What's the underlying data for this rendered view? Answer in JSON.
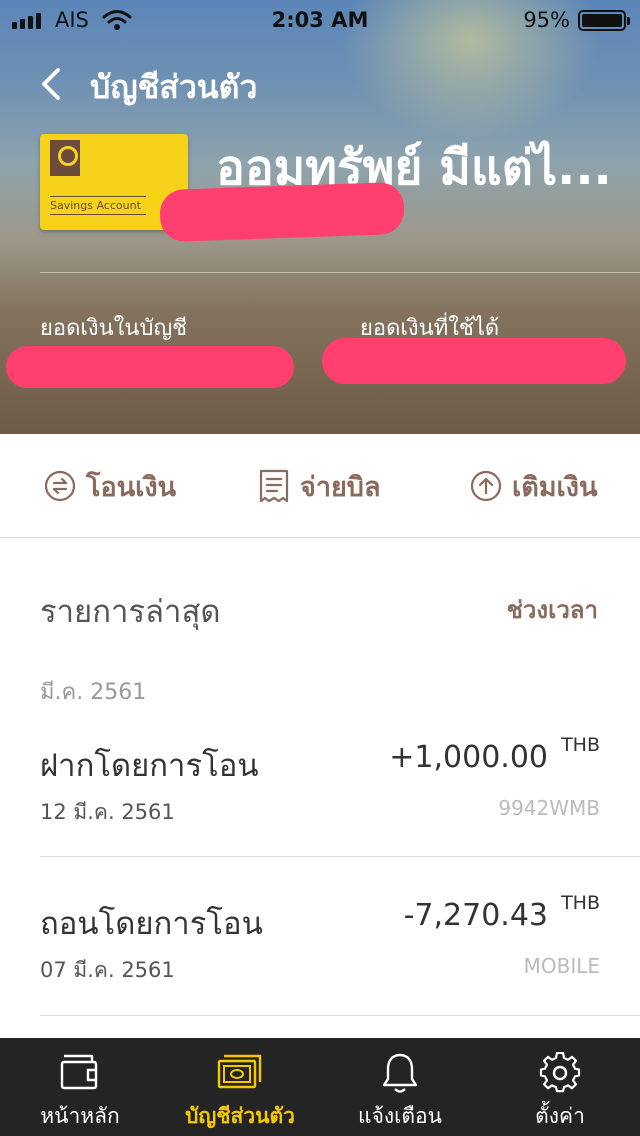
{
  "status_bar": {
    "carrier": "AIS",
    "time": "2:03 AM",
    "battery": "95%",
    "battery_level": 0.95
  },
  "header": {
    "back_icon": "chevron-left-icon",
    "title": "บัญชีส่วนตัว",
    "account_name": "ออมทรัพย์ มีแต่ไ...",
    "card_label": "Savings Account",
    "card_logo_text": "krungsri",
    "balance_label": "ยอดเงินในบัญชี",
    "available_label": "ยอดเงินที่ใช้ได้",
    "redaction_color": "#ff3f6e"
  },
  "actions": [
    {
      "icon": "transfer-icon",
      "label": "โอนเงิน"
    },
    {
      "icon": "bill-icon",
      "label": "จ่ายบิล"
    },
    {
      "icon": "top-up-icon",
      "label": "เติมเงิน"
    }
  ],
  "transactions": {
    "title": "รายการล่าสุด",
    "period_link": "ช่วงเวลา",
    "month": "มี.ค. 2561",
    "items": [
      {
        "title": "ฝากโดยการโอน",
        "amount": "+1,000.00",
        "currency": "THB",
        "date": "12 มี.ค. 2561",
        "channel": "9942WMB"
      },
      {
        "title": "ถอนโดยการโอน",
        "amount": "-7,270.43",
        "currency": "THB",
        "date": "07 มี.ค. 2561",
        "channel": "MOBILE"
      }
    ]
  },
  "tabbar": {
    "active_color": "#f5c800",
    "items": [
      {
        "icon": "wallet-icon",
        "label": "หน้าหลัก",
        "active": false
      },
      {
        "icon": "banknote-icon",
        "label": "บัญชีส่วนตัว",
        "active": true
      },
      {
        "icon": "bell-icon",
        "label": "แจ้งเตือน",
        "active": false
      },
      {
        "icon": "gear-icon",
        "label": "ตั้งค่า",
        "active": false
      }
    ]
  },
  "colors": {
    "accent_brown": "#8a6a5c",
    "brand_yellow": "#f7d21a"
  }
}
